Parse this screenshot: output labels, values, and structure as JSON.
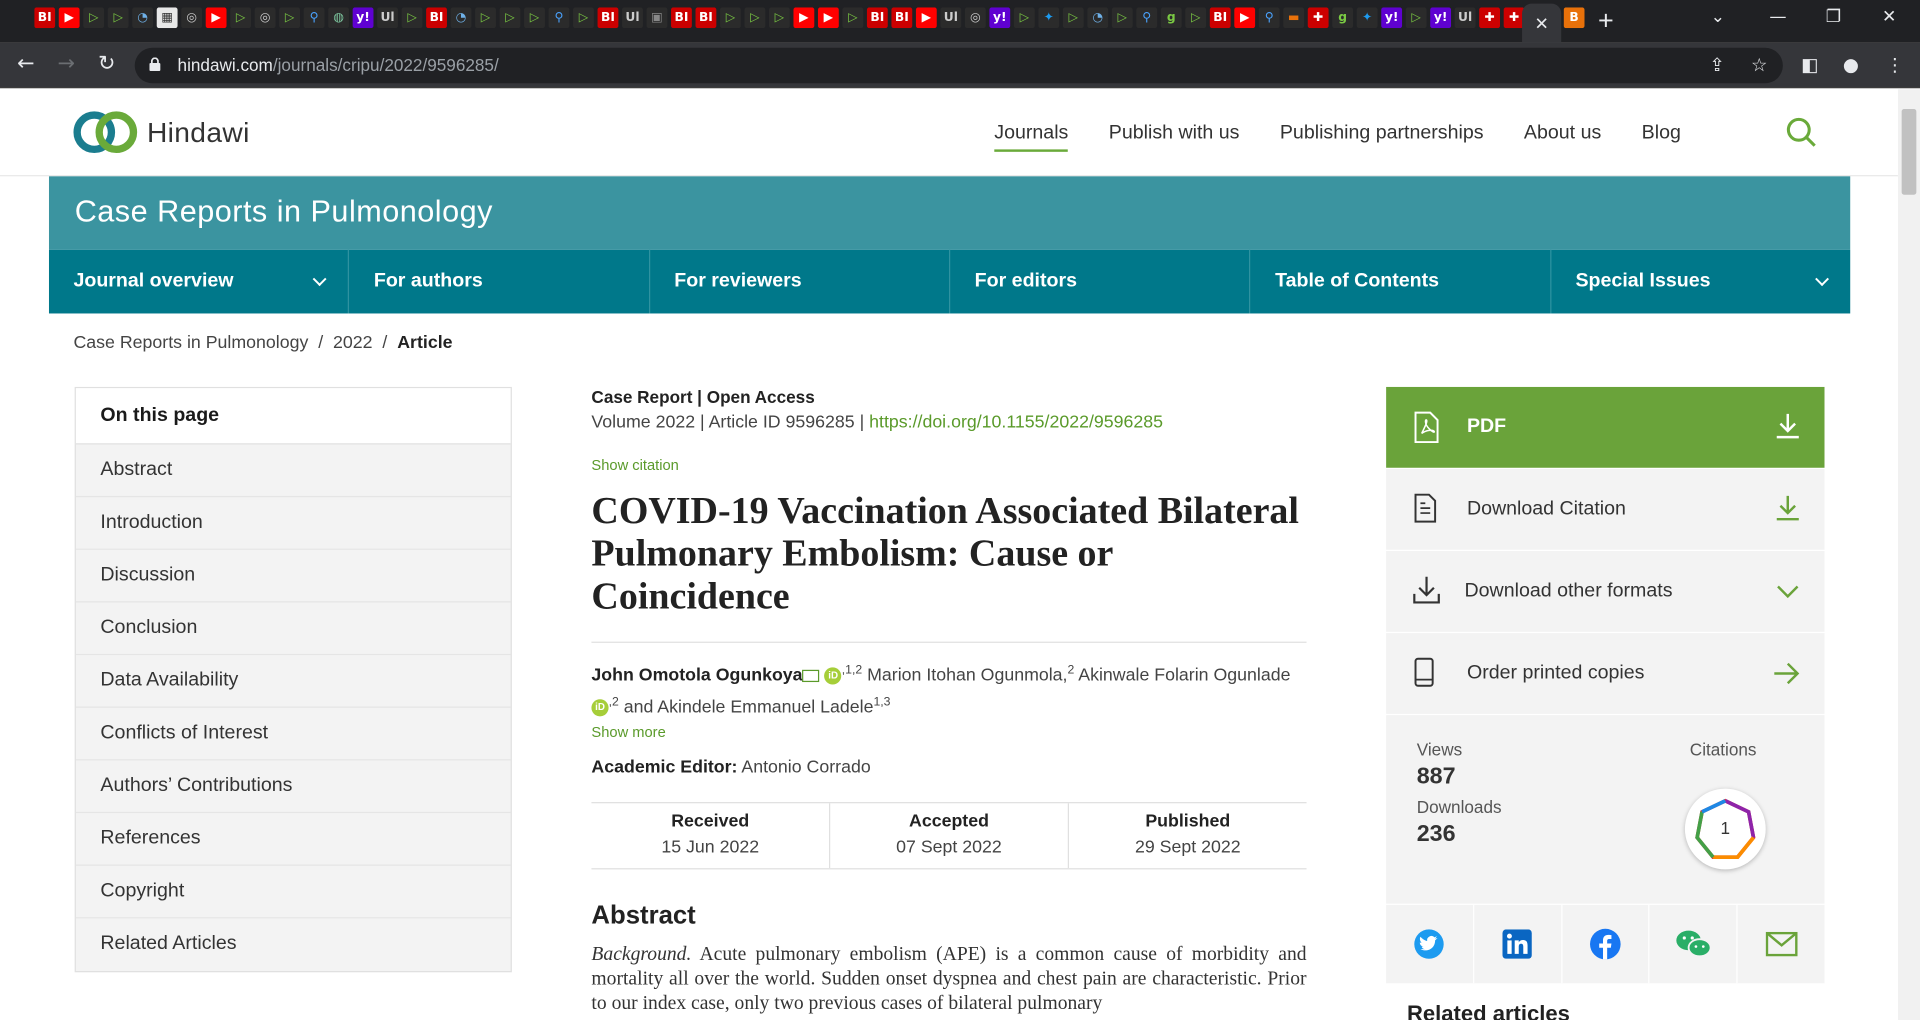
{
  "browser": {
    "url_host": "hindawi.com",
    "url_path": "/journals/cripu/2022/9596285/",
    "active_tab_icon": "close-icon",
    "tab_favicons": [
      "BI",
      "yt",
      "play",
      "play",
      "shield",
      "grid",
      "globe",
      "yt",
      "play",
      "globe",
      "play",
      "search",
      "bubble",
      "yahoo",
      "ul",
      "play",
      "BI",
      "shield",
      "play",
      "play",
      "play",
      "search",
      "play",
      "BI",
      "ul",
      "tab",
      "BI",
      "BI",
      "play",
      "play",
      "play",
      "yt",
      "yt",
      "play",
      "BI",
      "BI",
      "yt",
      "ul",
      "globe",
      "yahoo",
      "play",
      "twitter",
      "play",
      "shield",
      "play",
      "search",
      "g",
      "play",
      "BI",
      "yt",
      "search",
      "flag",
      "maple",
      "g",
      "twitter",
      "yahoo",
      "play",
      "yahoo",
      "ul",
      "maple",
      "maple"
    ]
  },
  "site": {
    "logo_text": "Hindawi",
    "nav": [
      "Journals",
      "Publish with us",
      "Publishing partnerships",
      "About us",
      "Blog"
    ],
    "active_nav": "Journals"
  },
  "journal": {
    "title": "Case Reports in Pulmonology",
    "nav": [
      "Journal overview",
      "For authors",
      "For reviewers",
      "For editors",
      "Table of Contents",
      "Special Issues"
    ]
  },
  "breadcrumb": {
    "items": [
      "Case Reports in Pulmonology",
      "2022",
      "Article"
    ],
    "sep": "/"
  },
  "toc": {
    "heading": "On this page",
    "items": [
      "Abstract",
      "Introduction",
      "Discussion",
      "Conclusion",
      "Data Availability",
      "Conflicts of Interest",
      "Authors’ Contributions",
      "References",
      "Copyright",
      "Related Articles"
    ]
  },
  "article": {
    "type": "Case Report | Open Access",
    "volume": "Volume 2022 | Article ID 9596285 | ",
    "doi": "https://doi.org/10.1155/2022/9596285",
    "show_citation": "Show citation",
    "title": "COVID-19 Vaccination Associated Bilateral Pulmonary Embolism: Cause or Coincidence",
    "authors": {
      "a1": "John Omotola Ogunkoya",
      "a1_sup": ",1,2",
      "a2": " Marion Itohan Ogunmola,",
      "a2_sup": "2",
      "a3": " Akinwale Folarin Ogunlade",
      "a3_sup": ",2",
      "a4": " and Akindele Emmanuel Ladele",
      "a4_sup": "1,3",
      "orcid": "iD"
    },
    "show_more": "Show more",
    "editor_label": "Academic Editor:",
    "editor_name": " Antonio Corrado",
    "dates": [
      {
        "label": "Received",
        "value": "15 Jun 2022"
      },
      {
        "label": "Accepted",
        "value": "07 Sept 2022"
      },
      {
        "label": "Published",
        "value": "29 Sept 2022"
      }
    ],
    "abstract_heading": "Abstract",
    "abstract_lead": "Background.",
    "abstract_text": " Acute pulmonary embolism (APE) is a common cause of morbidity and mortality all over the world. Sudden onset dyspnea and chest pain are characteristic. Prior to our index case, only two previous cases of bilateral pulmonary"
  },
  "sidebar": {
    "pdf": "PDF",
    "download_citation": "Download Citation",
    "download_other": "Download other formats",
    "order_printed": "Order printed copies",
    "views_label": "Views",
    "views": "887",
    "downloads_label": "Downloads",
    "downloads": "236",
    "citations_label": "Citations",
    "citations": "1",
    "social": [
      "twitter-icon",
      "linkedin-icon",
      "facebook-icon",
      "wechat-icon",
      "email-icon"
    ],
    "related_heading": "Related articles"
  },
  "colors": {
    "journal_header": "#3b94a0",
    "journal_nav": "#00788a",
    "accent_green": "#6aa33a",
    "link_green": "#5a9a2a"
  }
}
